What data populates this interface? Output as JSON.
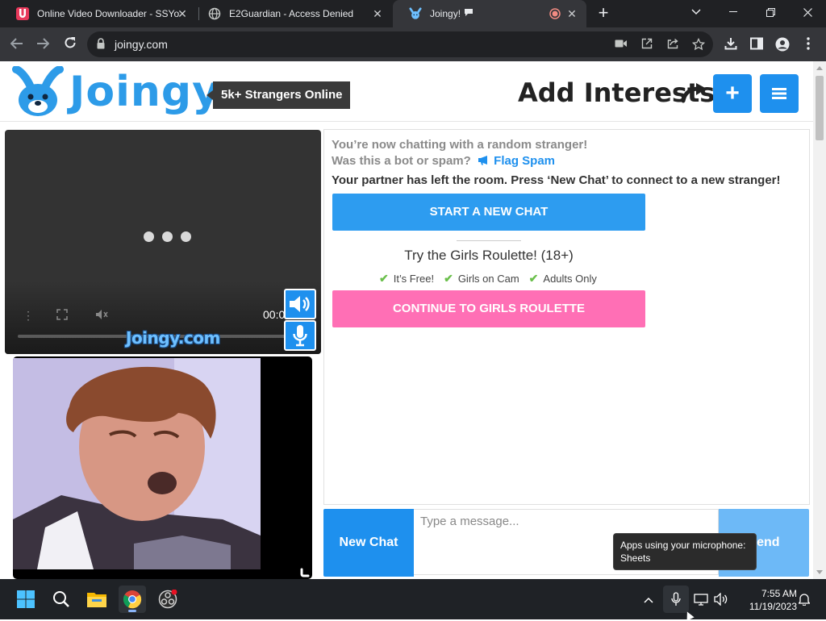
{
  "browser": {
    "tabs": [
      {
        "title": "Online Video Downloader - SSYo",
        "favicon": "ssyoutube-icon",
        "active": false
      },
      {
        "title": "E2Guardian - Access Denied",
        "favicon": "globe-icon",
        "active": false
      },
      {
        "title": "Joingy!",
        "favicon": "joingy-bunny-icon",
        "active": true,
        "indicators": [
          "chat-bubble-icon",
          "recording-icon"
        ]
      }
    ],
    "url": "joingy.com",
    "colors": {
      "tabstrip": "#202124",
      "toolbar": "#35363a"
    }
  },
  "header": {
    "logo_text": "Joingy",
    "online_badge": "5k+ Strangers Online",
    "add_interests": "Add Interests",
    "plus_label": "+",
    "colors": {
      "brand": "#2d9be8",
      "button": "#1e90ee"
    }
  },
  "video": {
    "remote_time": "00:0",
    "watermark": "Joingy.com"
  },
  "chat": {
    "line1": "You’re now chatting with a random stranger!",
    "line2": "Was this a bot or spam?",
    "flag_spam": "Flag Spam",
    "line3": "Your partner has left the room. Press ‘New Chat’ to connect to a new stranger!",
    "start_new_chat": "START A NEW CHAT",
    "roulette_title": "Try the Girls Roulette! (18+)",
    "perks": [
      "It’s Free!",
      "Girls on Cam",
      "Adults Only"
    ],
    "continue_roulette": "CONTINUE TO GIRLS ROULETTE",
    "colors": {
      "primary": "#2d9cf0",
      "roulette": "#ff6fb5",
      "check": "#6abf4b"
    }
  },
  "compose": {
    "new_chat": "New Chat",
    "placeholder": "Type a message...",
    "send": "Send"
  },
  "tooltip": {
    "line1": "Apps using your microphone:",
    "line2": "Sheets"
  },
  "taskbar": {
    "time": "7:55 AM",
    "date": "11/19/2023",
    "apps": [
      "windows-start-icon",
      "search-icon",
      "file-explorer-icon",
      "chrome-icon",
      "obs-icon"
    ]
  }
}
